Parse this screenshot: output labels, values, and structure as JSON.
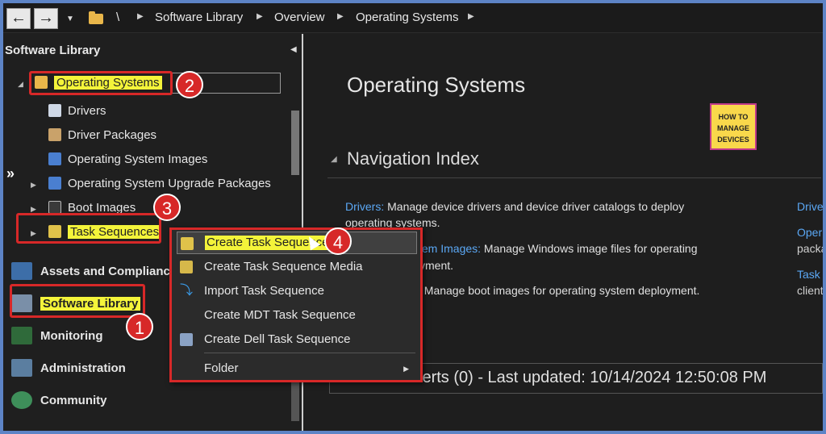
{
  "address_bar": {
    "root_sep": "\\",
    "breadcrumbs": [
      "Software Library",
      "Overview",
      "Operating Systems"
    ]
  },
  "left_pane": {
    "title": "Software Library",
    "tree": [
      {
        "label": "Operating Systems"
      },
      {
        "label": "Drivers"
      },
      {
        "label": "Driver Packages"
      },
      {
        "label": "Operating System Images"
      },
      {
        "label": "Operating System Upgrade Packages"
      },
      {
        "label": "Boot Images"
      },
      {
        "label": "Task Sequences"
      }
    ],
    "workspaces": [
      {
        "label": "Assets and Compliance"
      },
      {
        "label": "Software Library"
      },
      {
        "label": "Monitoring"
      },
      {
        "label": "Administration"
      },
      {
        "label": "Community"
      }
    ]
  },
  "main": {
    "title": "Operating Systems",
    "logo_lines": [
      "HOW TO",
      "MANAGE",
      "DEVICES"
    ],
    "section": "Navigation Index",
    "drivers_link": "Drivers:",
    "drivers_desc": " Manage device drivers and device driver catalogs to deploy",
    "drivers_desc2": "operating systems.",
    "images_link": "stem Images:",
    "images_desc": " Manage Windows image files for operating",
    "images_desc2": "yment.",
    "boot_desc": ": Manage boot images for operating system deployment.",
    "edge_links": [
      "Drive",
      "Oper",
      "Task"
    ],
    "edge_texts": [
      "packa",
      "client"
    ],
    "alerts": "lerts (0) - Last updated: 10/14/2024 12:50:08 PM"
  },
  "context_menu": {
    "items": [
      {
        "label": "Create Task Sequence"
      },
      {
        "label": "Create Task Sequence Media"
      },
      {
        "label": "Import Task Sequence"
      },
      {
        "label": "Create MDT Task Sequence"
      },
      {
        "label": "Create Dell Task Sequence"
      },
      {
        "label": "Folder"
      }
    ]
  },
  "badges": [
    "1",
    "2",
    "3",
    "4"
  ],
  "colors": {
    "highlight": "#f4f43a",
    "callout": "#d72828",
    "link": "#5ba8f5"
  }
}
